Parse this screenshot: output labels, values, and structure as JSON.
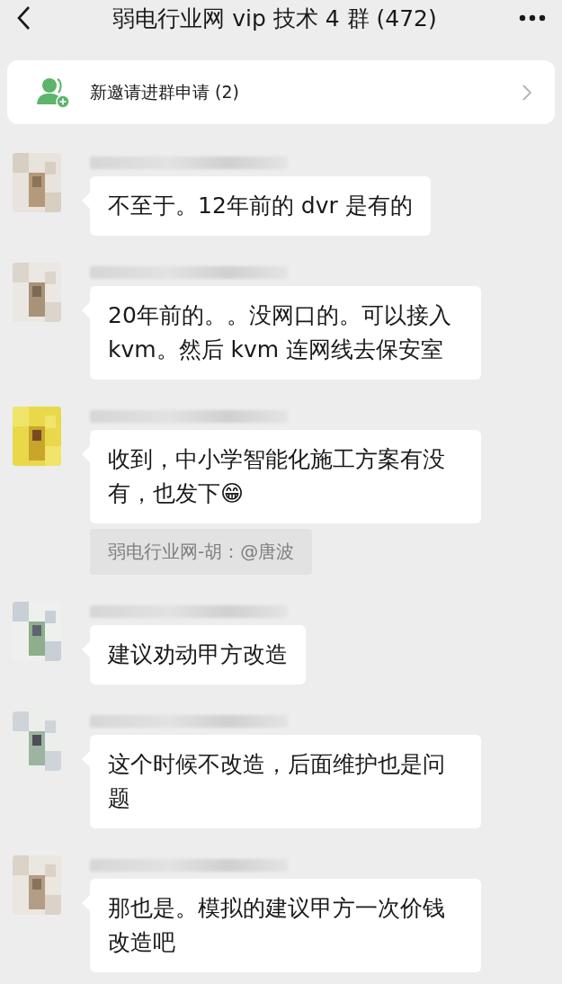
{
  "header": {
    "title": "弱电行业网 vip 技术 4 群 (472)"
  },
  "invite_banner": {
    "label": "新邀请进群申请 (2)"
  },
  "messages": [
    {
      "text": "不至于。12年前的 dvr 是有的"
    },
    {
      "text": "20年前的。。没网口的。可以接入 kvm。然后 kvm 连网线去保安室"
    },
    {
      "text": "收到，中小学智能化施工方案有没有，也发下😁",
      "quote": "弱电行业网-胡：@唐波"
    },
    {
      "text": "建议劝动甲方改造"
    },
    {
      "text": "这个时候不改造，后面维护也是问题"
    },
    {
      "text": "那也是。模拟的建议甲方一次价钱改造吧"
    }
  ]
}
